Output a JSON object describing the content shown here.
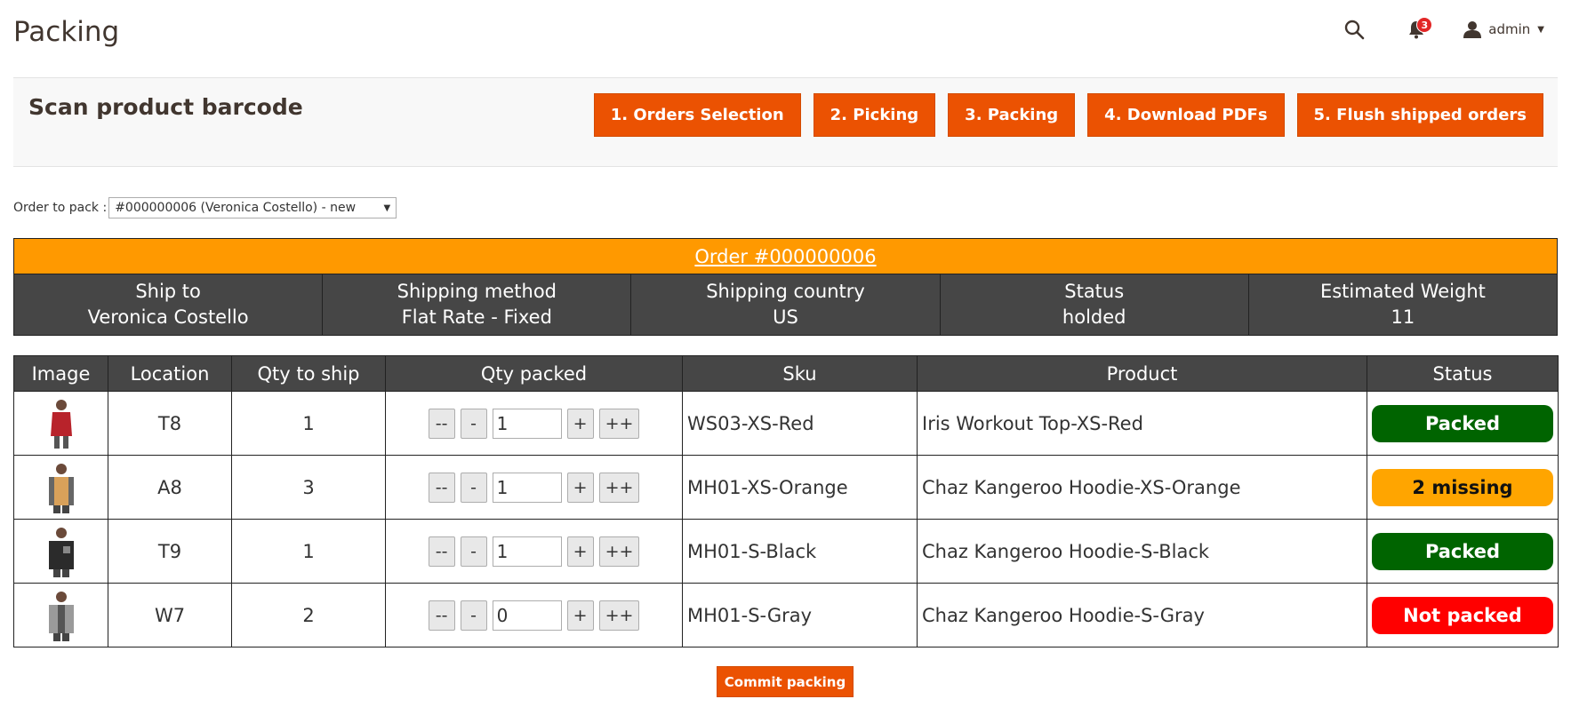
{
  "page": {
    "title": "Packing"
  },
  "header": {
    "notifications_count": "3",
    "user_name": "admin"
  },
  "actionbar": {
    "title": "Scan product barcode",
    "steps": [
      "1. Orders Selection",
      "2. Picking",
      "3. Packing",
      "4. Download PDFs",
      "5. Flush shipped orders"
    ]
  },
  "order_select": {
    "label": "Order to pack :",
    "value": "#000000006 (Veronica Costello) - new"
  },
  "order": {
    "title": "Order #000000006",
    "info": [
      {
        "label": "Ship to",
        "value": "Veronica Costello"
      },
      {
        "label": "Shipping method",
        "value": "Flat Rate - Fixed"
      },
      {
        "label": "Shipping country",
        "value": "US"
      },
      {
        "label": "Status",
        "value": "holded"
      },
      {
        "label": "Estimated Weight",
        "value": "11"
      }
    ]
  },
  "items_table": {
    "columns": [
      "Image",
      "Location",
      "Qty to ship",
      "Qty packed",
      "Sku",
      "Product",
      "Status"
    ],
    "qty_buttons": {
      "minus_all": "--",
      "minus": "-",
      "plus": "+",
      "plus_all": "++"
    },
    "rows": [
      {
        "location": "T8",
        "qty_to_ship": "1",
        "qty_packed": "1",
        "sku": "WS03-XS-Red",
        "product": "Iris Workout Top-XS-Red",
        "status": "Packed",
        "status_color": "#006400",
        "image_color": "#b8232b"
      },
      {
        "location": "A8",
        "qty_to_ship": "3",
        "qty_packed": "1",
        "sku": "MH01-XS-Orange",
        "product": "Chaz Kangeroo Hoodie-XS-Orange",
        "status": "2 missing",
        "status_color": "#ffa500",
        "image_color": "#d9a15a"
      },
      {
        "location": "T9",
        "qty_to_ship": "1",
        "qty_packed": "1",
        "sku": "MH01-S-Black",
        "product": "Chaz Kangeroo Hoodie-S-Black",
        "status": "Packed",
        "status_color": "#006400",
        "image_color": "#2b2b2b"
      },
      {
        "location": "W7",
        "qty_to_ship": "2",
        "qty_packed": "0",
        "sku": "MH01-S-Gray",
        "product": "Chaz Kangeroo Hoodie-S-Gray",
        "status": "Not packed",
        "status_color": "#ff0000",
        "image_color": "#9a9a9a"
      }
    ]
  },
  "commit_button": "Commit packing",
  "colors": {
    "accent": "#eb5202",
    "order_bar": "#ff9900",
    "header_dark": "#464646"
  }
}
